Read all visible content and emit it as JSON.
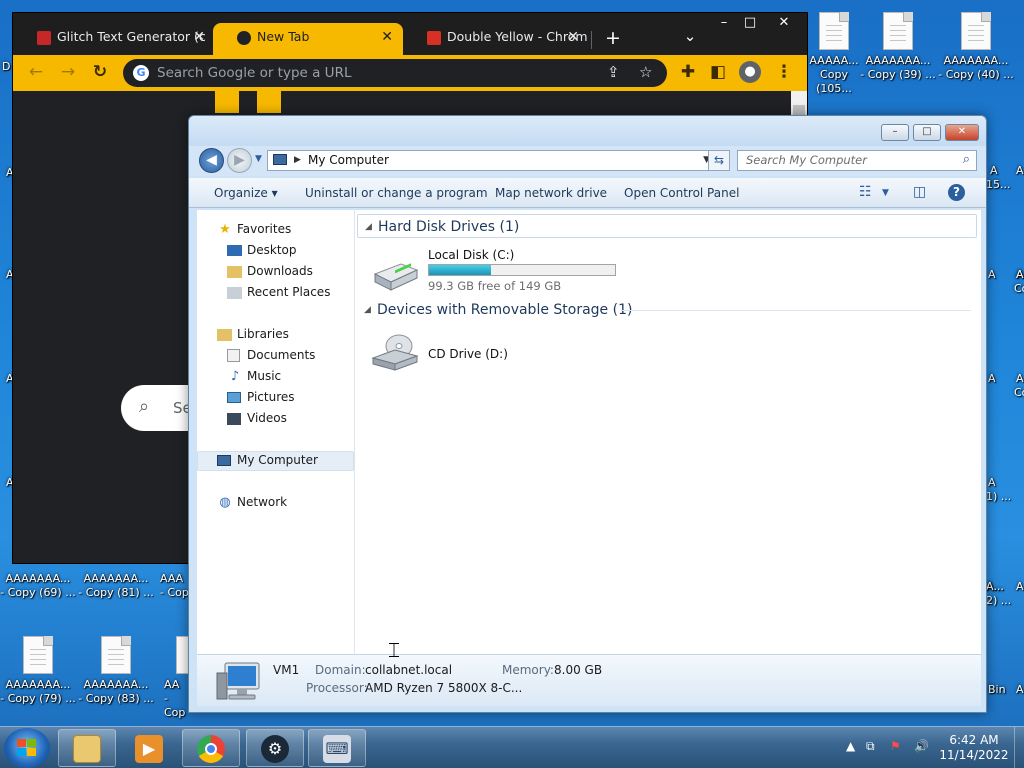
{
  "chrome": {
    "tabs": [
      {
        "label": "Glitch Text Generator (c"
      },
      {
        "label": "New Tab"
      },
      {
        "label": "Double Yellow - Chrom"
      }
    ],
    "new_tab": "+",
    "tab_search": "⌄",
    "window_controls": {
      "minimize": "–",
      "maximize": "□",
      "close": "✕"
    },
    "omnibox_placeholder": "Search Google or type a URL",
    "content_search_fragment": "Se"
  },
  "desktop": {
    "top_icons": [
      {
        "line1": "AAAAA...",
        "line2": "Copy (105..."
      },
      {
        "line1": "AAAAAAA...",
        "line2": "- Copy (39) ..."
      },
      {
        "line1": "AAAAAAA...",
        "line2": "- Copy (40) ..."
      }
    ],
    "bottom_icons_row1": [
      {
        "line1": "AAAAAAA...",
        "line2": "- Copy (69) ..."
      },
      {
        "line1": "AAAAAAA...",
        "line2": "- Copy (81) ..."
      },
      {
        "line1": "AAA",
        "line2": "- Cop"
      }
    ],
    "bottom_icons_row2": [
      {
        "line1": "AAAAAAA...",
        "line2": "- Copy (79) ..."
      },
      {
        "line1": "AAAAAAA...",
        "line2": "- Copy (83) ..."
      },
      {
        "line1": "AA",
        "line2": "- Cop"
      }
    ],
    "left_edge": [
      "D",
      "A",
      "A",
      "A",
      "A"
    ],
    "right_edge_a": [
      "A",
      "15...",
      "A",
      "A",
      "A",
      "A...",
      "1) ...",
      "A...",
      "2) ...",
      "Bin"
    ],
    "right_edge_b": [
      "A",
      "A",
      "A",
      "Co...",
      "A",
      "Co...",
      "A",
      "A"
    ]
  },
  "explorer": {
    "window_controls": {
      "minimize": "–",
      "maximize": "□",
      "close": "✕"
    },
    "address_path": "My Computer",
    "search_placeholder": "Search My Computer",
    "commands": {
      "organize": "Organize ▾",
      "uninstall": "Uninstall or change a program",
      "map_drive": "Map network drive",
      "control_panel": "Open Control Panel"
    },
    "nav": {
      "favorites": "Favorites",
      "desktop": "Desktop",
      "downloads": "Downloads",
      "recent": "Recent Places",
      "libraries": "Libraries",
      "documents": "Documents",
      "music": "Music",
      "pictures": "Pictures",
      "videos": "Videos",
      "my_computer": "My Computer",
      "network": "Network"
    },
    "groups": {
      "hard_disks": "Hard Disk Drives (1)",
      "removable": "Devices with Removable Storage (1)"
    },
    "drives": {
      "c_name": "Local Disk (C:)",
      "c_free": "99.3 GB free of 149 GB",
      "c_used_fraction": 0.334,
      "d_name": "CD Drive (D:)"
    },
    "details": {
      "computer_name": "VM1",
      "domain_label": "Domain:",
      "domain_value": "collabnet.local",
      "memory_label": "Memory:",
      "memory_value": "8.00 GB",
      "processor_label": "Processor:",
      "processor_value": "AMD Ryzen 7 5800X 8-C..."
    }
  },
  "taskbar": {
    "clock_time": "6:42 AM",
    "clock_date": "11/14/2022"
  },
  "colors": {
    "chrome_accent": "#f7b900",
    "desktop_blue": "#1f86d9",
    "drive_bar": "#1b93b8"
  }
}
